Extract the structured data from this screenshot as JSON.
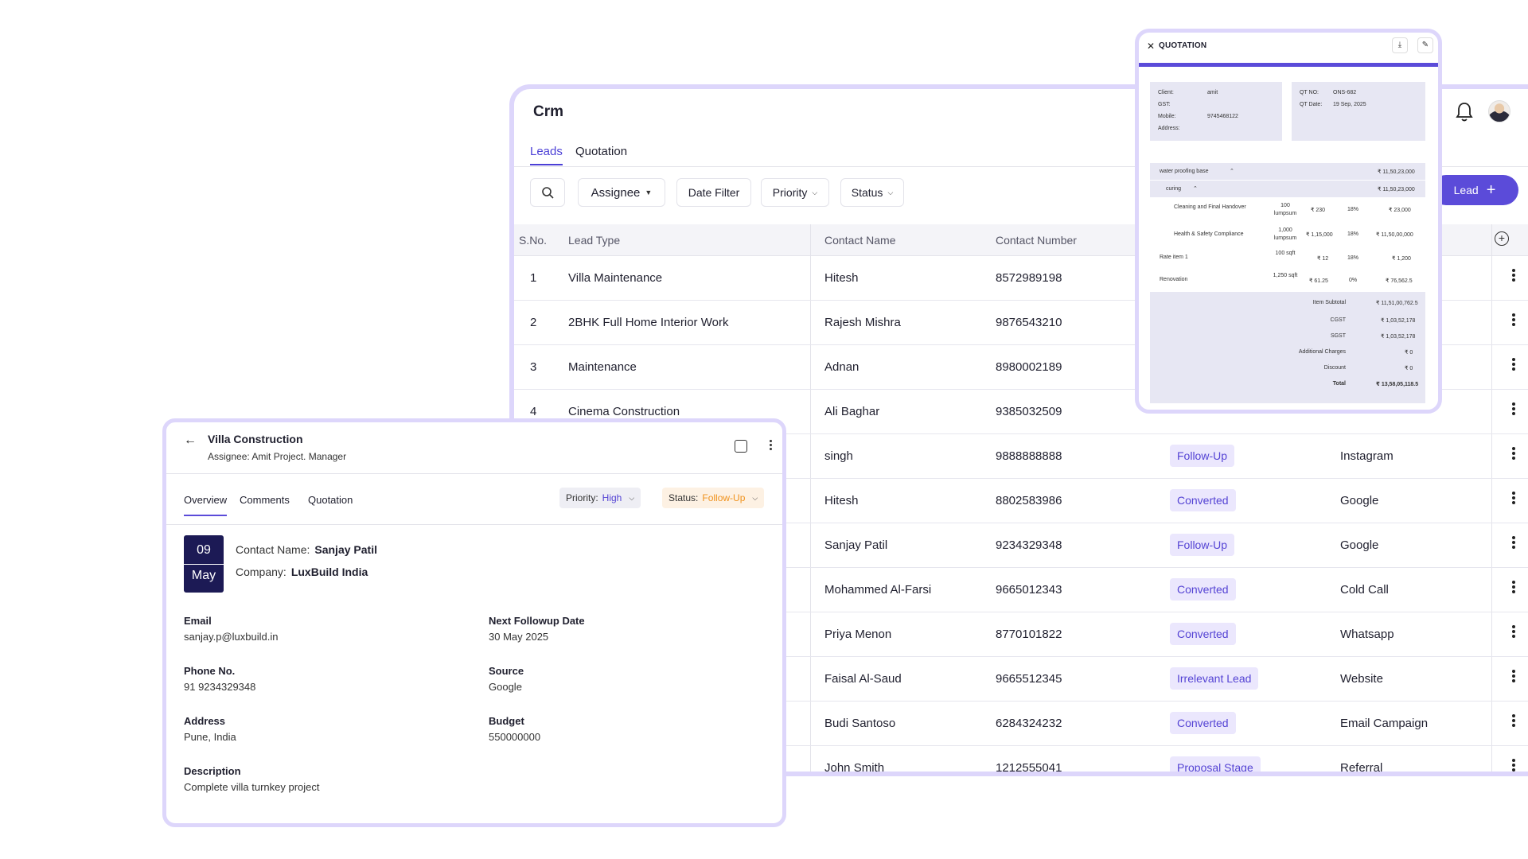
{
  "crm": {
    "title": "Crm",
    "tabs": [
      {
        "label": "Leads"
      },
      {
        "label": "Quotation"
      }
    ],
    "filters": {
      "assignee": "Assignee",
      "date": "Date Filter",
      "priority": "Priority",
      "status": "Status"
    },
    "add_lead_label": "Lead",
    "columns": [
      "S.No.",
      "Lead Type",
      "Contact Name",
      "Contact Number"
    ],
    "rows": [
      {
        "sno": "1",
        "type": "Villa Maintenance",
        "name": "Hitesh",
        "phone": "8572989198",
        "status": "",
        "source": ""
      },
      {
        "sno": "2",
        "type": "2BHK Full Home Interior Work",
        "name": "Rajesh Mishra",
        "phone": "9876543210",
        "status": "",
        "source": ""
      },
      {
        "sno": "3",
        "type": "Maintenance",
        "name": "Adnan",
        "phone": "8980002189",
        "status": "",
        "source": ""
      },
      {
        "sno": "4",
        "type": "Cinema Construction",
        "name": "Ali Baghar",
        "phone": "9385032509",
        "status": "",
        "source": ""
      },
      {
        "sno": "",
        "type": "",
        "name": "singh",
        "phone": "9888888888",
        "status": "Follow-Up",
        "source": "Instagram"
      },
      {
        "sno": "",
        "type": "",
        "name": "Hitesh",
        "phone": "8802583986",
        "status": "Converted",
        "source": "Google"
      },
      {
        "sno": "",
        "type": "",
        "name": "Sanjay Patil",
        "phone": "9234329348",
        "status": "Follow-Up",
        "source": "Google"
      },
      {
        "sno": "",
        "type": "",
        "name": "Mohammed Al-Farsi",
        "phone": "9665012343",
        "status": "Converted",
        "source": "Cold Call"
      },
      {
        "sno": "",
        "type": "",
        "name": "Priya Menon",
        "phone": "8770101822",
        "status": "Converted",
        "source": "Whatsapp"
      },
      {
        "sno": "",
        "type": "",
        "name": "Faisal Al-Saud",
        "phone": "9665512345",
        "status": "Irrelevant Lead",
        "source": "Website"
      },
      {
        "sno": "",
        "type": "",
        "name": "Budi Santoso",
        "phone": "6284324232",
        "status": "Converted",
        "source": "Email Campaign"
      },
      {
        "sno": "",
        "type": "",
        "name": "John Smith",
        "phone": "1212555041",
        "status": "Proposal Stage",
        "source": "Referral"
      }
    ]
  },
  "quotation": {
    "title": "QUOTATION",
    "client_label": "Client:",
    "client": "amit",
    "gst_label": "GST:",
    "mobile_label": "Mobile:",
    "mobile": "9745468122",
    "address_label": "Address:",
    "qtno_label": "QT NO:",
    "qtno": "ONS-682",
    "qtdate_label": "QT Date:",
    "qtdate": "19 Sep, 2025",
    "items": [
      {
        "name": "water proofing base",
        "qty": "",
        "rate": "",
        "tax": "",
        "amount": "₹ 11,50,23,000"
      },
      {
        "name": "curing",
        "qty": "",
        "rate": "",
        "tax": "",
        "amount": "₹ 11,50,23,000"
      },
      {
        "name": "Cleaning and Final Handover",
        "qty": "100 lumpsum",
        "rate": "₹ 230",
        "tax": "18%",
        "amount": "₹ 23,000"
      },
      {
        "name": "Health & Safety Compliance",
        "qty": "1,000 lumpsum",
        "rate": "₹ 1,15,000",
        "tax": "18%",
        "amount": "₹ 11,50,00,000"
      },
      {
        "name": "Rate item 1",
        "qty": "100 sqft",
        "rate": "₹ 12",
        "tax": "18%",
        "amount": "₹ 1,200"
      },
      {
        "name": "Renovation",
        "qty": "1,250 sqft",
        "rate": "₹ 61.25",
        "tax": "0%",
        "amount": "₹ 76,562.5"
      }
    ],
    "subtotal_label": "Item Subtotal",
    "subtotal": "₹ 11,51,00,762.5",
    "cgst_label": "CGST",
    "cgst": "₹ 1,03,52,178",
    "sgst_label": "SGST",
    "sgst": "₹ 1,03,52,178",
    "additional_label": "Additional Charges",
    "additional": "₹ 0",
    "discount_label": "Discount",
    "discount": "₹ 0",
    "total_label": "Total",
    "total": "₹ 13,58,05,118.5"
  },
  "detail": {
    "title": "Villa Construction",
    "assignee": "Assignee: Amit Project. Manager",
    "tabs": [
      {
        "label": "Overview"
      },
      {
        "label": "Comments"
      },
      {
        "label": "Quotation"
      }
    ],
    "priority_label": "Priority:",
    "priority": "High",
    "status_label": "Status:",
    "status": "Follow-Up",
    "day": "09",
    "month": "May",
    "contact_label": "Contact Name:",
    "contact": "Sanjay Patil",
    "company_label": "Company:",
    "company": "LuxBuild India",
    "email_label": "Email",
    "email": "sanjay.p@luxbuild.in",
    "followup_label": "Next Followup Date",
    "followup": "30 May 2025",
    "phone_label": "Phone No.",
    "phone": "91 9234329348",
    "source_label": "Source",
    "source": "Google",
    "address_label": "Address",
    "address": "Pune, India",
    "budget_label": "Budget",
    "budget": "550000000",
    "description_label": "Description",
    "description": "Complete villa turnkey project"
  },
  "colors": {
    "accent": "#5b4bd9",
    "frame": "#ddd6fb",
    "date_box": "#1c1a55",
    "status_orange": "#f0921d"
  },
  "icons": [
    "search-icon",
    "bell-icon",
    "plus-icon",
    "plus-circle-icon",
    "kebab-icon",
    "close-icon",
    "download-icon",
    "edit-icon",
    "back-arrow-icon",
    "chevron-down-icon"
  ]
}
